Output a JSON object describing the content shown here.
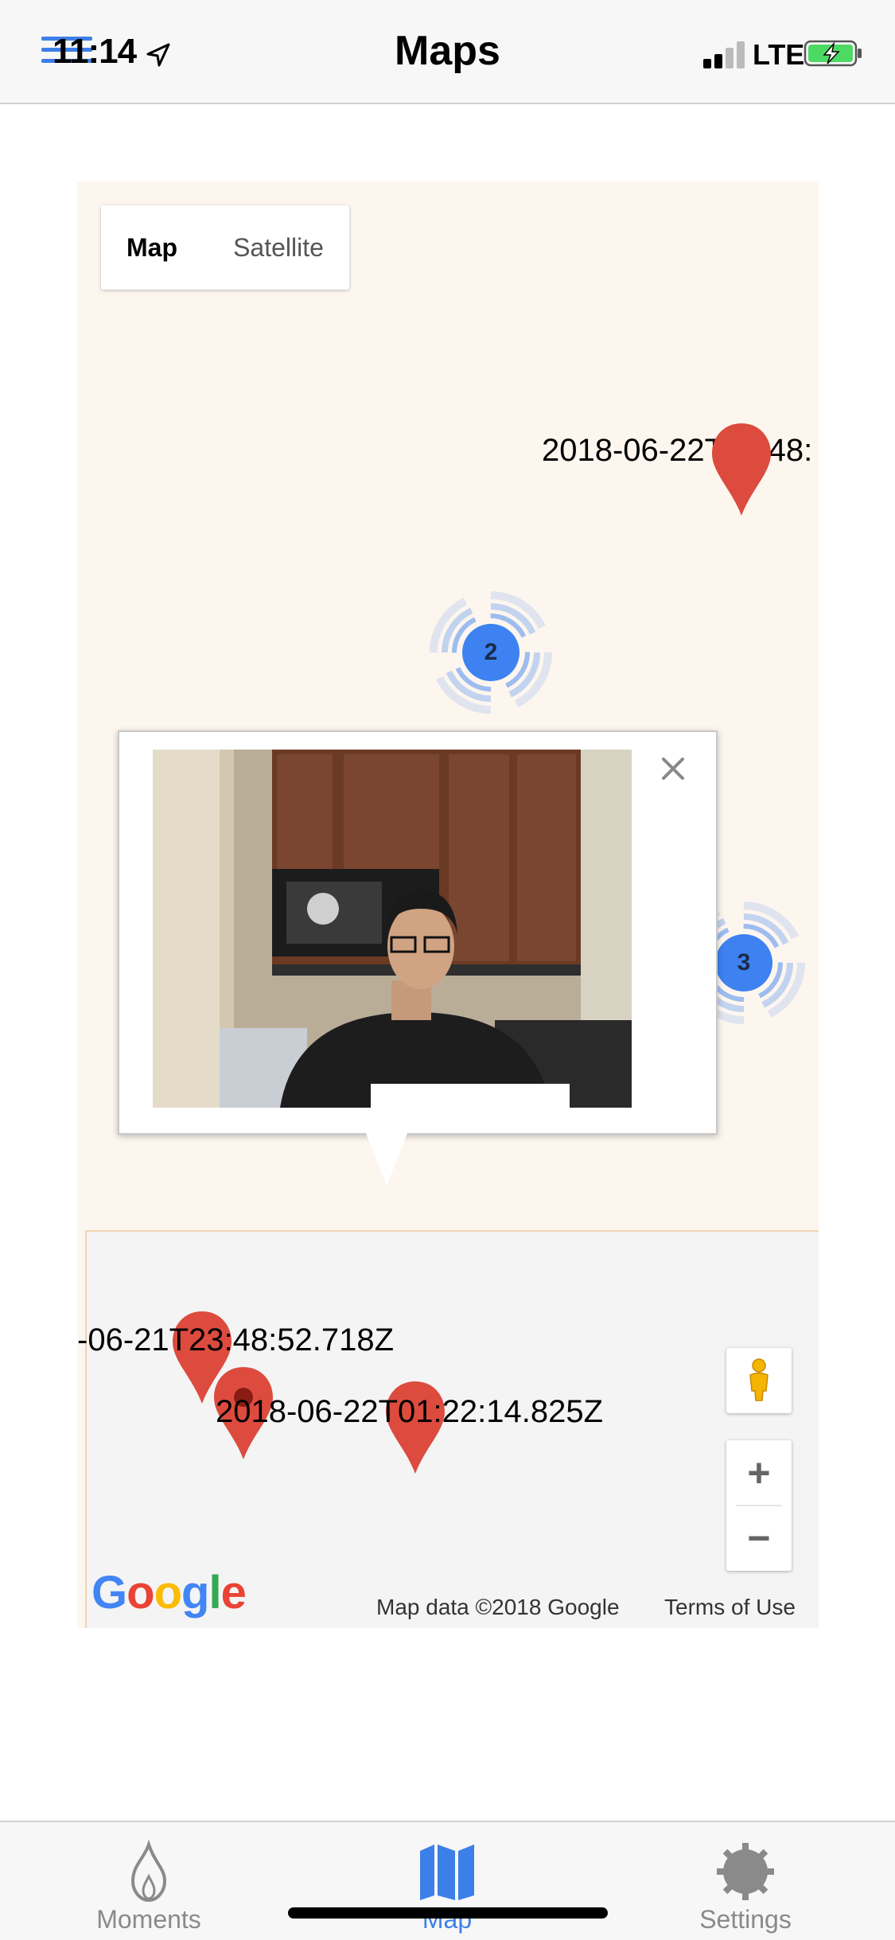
{
  "status_bar": {
    "time": "11:14",
    "network": "LTE"
  },
  "header": {
    "title": "Maps"
  },
  "map": {
    "type_control": {
      "map_label": "Map",
      "satellite_label": "Satellite"
    },
    "markers": [
      {
        "label": "2018-06-22T03:48:"
      },
      {
        "label": "-06-21T23:48:52.718Z"
      },
      {
        "label": "2018-06-22T01:22:14.825Z"
      }
    ],
    "clusters": [
      {
        "count": "2"
      },
      {
        "count": "3"
      }
    ],
    "info_window": {
      "photo": "person-in-kitchen-photo"
    },
    "zoom": {
      "in_label": "+",
      "out_label": "−"
    },
    "google_logo": "Google",
    "attribution": "Map data ©2018 Google",
    "terms": "Terms of Use"
  },
  "colors": {
    "accent": "#3d7fe8",
    "pin": "#dc4b3e",
    "cluster": "#3d82f0",
    "map_bg": "#fdf6ef"
  },
  "tabbar": {
    "tabs": [
      {
        "label": "Moments",
        "icon": "flame-icon"
      },
      {
        "label": "Map",
        "icon": "map-icon"
      },
      {
        "label": "Settings",
        "icon": "gear-icon"
      }
    ]
  }
}
